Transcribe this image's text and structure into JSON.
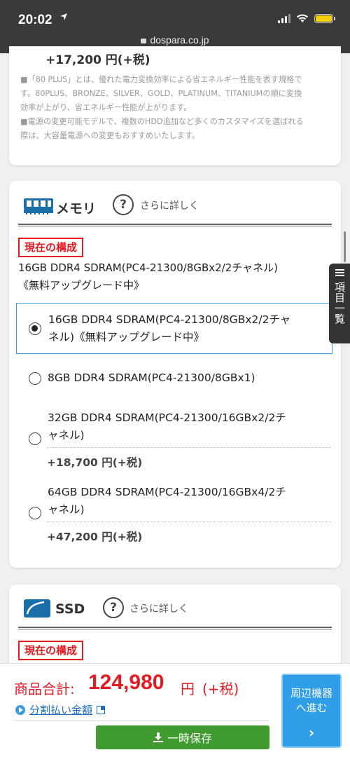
{
  "status_bar": {
    "time": "20:02",
    "url": "dospara.co.jp"
  },
  "psu_section": {
    "price": "+17,200 円(+税)",
    "note_lines": [
      "■「80 PLUS」とは、優れた電力変換効率による省エネルギー性能を表す規格で",
      "す。80PLUS、BRONZE、SILVER、GOLD、PLATINUM、TITANIUMの順に変換",
      "効率が上がり、省エネルギー性能が上がります。",
      "■電源の変更可能モデルで、複数のHDD追加など多くのカスタマイズを選ばれる",
      "際は、大容量電源への変更もおすすめいたします。"
    ]
  },
  "memory_section": {
    "title": "メモリ",
    "help_label": "さらに詳しく",
    "current_badge": "現在の構成",
    "current_lines": [
      "16GB DDR4 SDRAM(PC4-21300/8GBx2/2チャネル)",
      "《無料アップグレード中》"
    ],
    "options": [
      {
        "lines": [
          "16GB DDR4 SDRAM(PC4-21300/8GBx2/2チャ",
          "ネル)《無料アップグレード中》"
        ],
        "price": "",
        "selected": true
      },
      {
        "lines": [
          "8GB DDR4 SDRAM(PC4-21300/8GBx1)"
        ],
        "price": "",
        "selected": false
      },
      {
        "lines": [
          "32GB DDR4 SDRAM(PC4-21300/16GBx2/2チ",
          "ャネル)"
        ],
        "price": "+18,700 円(+税)",
        "selected": false
      },
      {
        "lines": [
          "64GB DDR4 SDRAM(PC4-21300/16GBx4/2チ",
          "ャネル)"
        ],
        "price": "+47,200 円(+税)",
        "selected": false
      }
    ]
  },
  "ssd_section": {
    "title": "SSD",
    "help_label": "さらに詳しく",
    "current_badge": "現在の構成"
  },
  "side_tab": {
    "label": "項目一覧"
  },
  "footer": {
    "total_label": "商品合計:",
    "total_amount": "124,980",
    "total_unit": "円",
    "total_tax": "(+税)",
    "installment_label": "分割払い金額",
    "save_label": "一時保存",
    "next_label_1": "周辺機器",
    "next_label_2": "へ進む",
    "next_chevron": "›"
  },
  "colors": {
    "accent_red": "#e31b23",
    "primary_blue": "#2f9ee6",
    "save_green": "#3f9a2f",
    "link_blue": "#1a6fc0"
  }
}
